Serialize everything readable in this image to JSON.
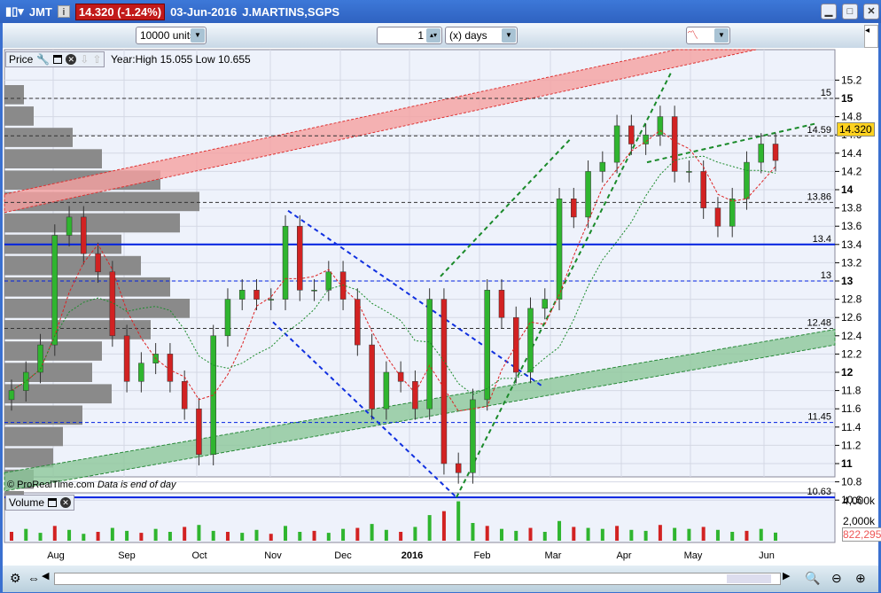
{
  "header": {
    "symbol": "JMT",
    "price_badge": "14.320 (-1.24%)",
    "date": "03-Jun-2016",
    "name": "J.MARTINS,SGPS",
    "info": "i"
  },
  "toolbar": {
    "units": "10000 units",
    "period_value": "1",
    "period_unit": "(x) days"
  },
  "price_panel": {
    "label": "Price",
    "range_text": "Year:High 15.055 Low 10.655",
    "last_price": "14.320",
    "footer": "© ProRealTime.com",
    "footer_note": "Data is end of day"
  },
  "volume_panel": {
    "label": "Volume",
    "last_volume": "822,295",
    "ticks": [
      "4,000k",
      "2,000k"
    ]
  },
  "colors": {
    "up": "#2fb52f",
    "down": "#d22222",
    "title": "#2f62c0"
  },
  "chart_data": {
    "type": "candlestick",
    "ylim": [
      10.55,
      15.3
    ],
    "y_ticks": [
      15.2,
      15,
      14.8,
      14.6,
      14.4,
      14.2,
      14,
      13.8,
      13.6,
      13.4,
      13.2,
      13,
      12.8,
      12.6,
      12.4,
      12.2,
      12,
      11.8,
      11.6,
      11.4,
      11.2,
      11,
      10.8,
      10.6
    ],
    "x_labels": [
      "Aug",
      "Sep",
      "Oct",
      "Nov",
      "Dec",
      "2016",
      "Feb",
      "Mar",
      "Apr",
      "May",
      "Jun"
    ],
    "levels": [
      {
        "v": 15,
        "label": "15",
        "style": "dash"
      },
      {
        "v": 14.59,
        "label": "14.59",
        "style": "dash"
      },
      {
        "v": 13.86,
        "label": "13.86",
        "style": "dash"
      },
      {
        "v": 13.4,
        "label": "13.4",
        "style": "solid"
      },
      {
        "v": 13,
        "label": "13",
        "style": "dash"
      },
      {
        "v": 12.48,
        "label": "12.48",
        "style": "dash"
      },
      {
        "v": 11.45,
        "label": "11.45",
        "style": "dash"
      },
      {
        "v": 10.63,
        "label": "10.63",
        "style": "solid"
      }
    ],
    "closes": [
      11.8,
      12.0,
      12.3,
      13.5,
      13.7,
      13.3,
      13.1,
      12.4,
      11.9,
      12.1,
      12.2,
      11.9,
      11.6,
      11.1,
      12.4,
      12.8,
      12.9,
      12.8,
      12.8,
      13.6,
      12.9,
      12.9,
      13.1,
      12.8,
      12.3,
      11.6,
      12.0,
      11.9,
      11.6,
      12.8,
      11.0,
      10.9,
      11.7,
      12.9,
      12.6,
      12.0,
      12.7,
      12.8,
      13.9,
      13.7,
      14.2,
      14.3,
      14.7,
      14.5,
      14.6,
      14.8,
      14.2,
      14.2,
      13.8,
      13.6,
      13.9,
      14.3,
      14.5,
      14.32
    ],
    "volumes": [
      900,
      1200,
      800,
      1500,
      1100,
      700,
      900,
      1300,
      1000,
      800,
      1200,
      900,
      1400,
      1600,
      1000,
      900,
      800,
      1100,
      700,
      1500,
      900,
      1000,
      800,
      1200,
      1300,
      1700,
      1100,
      900,
      1400,
      2600,
      3000,
      4000,
      1800,
      1500,
      1200,
      1000,
      1300,
      900,
      2000,
      1400,
      1300,
      1200,
      1500,
      1100,
      1000,
      1600,
      1300,
      1200,
      1400,
      1100,
      900,
      1000,
      1200,
      822
    ],
    "volume_profile": [
      0.1,
      0.15,
      0.35,
      0.5,
      0.8,
      1,
      0.9,
      0.6,
      0.7,
      0.85,
      0.95,
      0.75,
      0.5,
      0.45,
      0.55,
      0.4,
      0.3,
      0.25,
      0.15,
      0.1
    ]
  }
}
